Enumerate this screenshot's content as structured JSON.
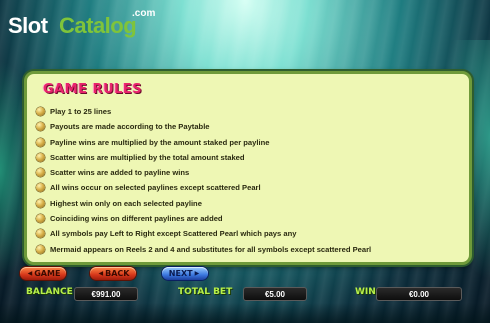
{
  "logo": {
    "slot": "Slot",
    "catalog": "Catalog",
    "com": ".com"
  },
  "panel": {
    "title": "GAME RULES",
    "rules": [
      "Play 1 to 25 lines",
      "Payouts are made according to the Paytable",
      "Payline wins are multiplied by the amount staked per payline",
      "Scatter wins are multiplied by the total amount staked",
      "Scatter wins are added to payline wins",
      "All wins occur on selected paylines except scattered Pearl",
      "Highest win only on each selected payline",
      "Coinciding wins on different paylines are added",
      "All symbols pay Left to Right except Scattered Pearl which pays any",
      "Mermaid appears on Reels 2 and 4 and substitutes for all symbols except scattered Pearl"
    ]
  },
  "nav": {
    "game_label": "GAME",
    "back_label": "BACK",
    "next_label": "NEXT"
  },
  "status": {
    "balance_label": "BALANCE",
    "balance_value": "€991.00",
    "total_bet_label": "TOTAL BET",
    "total_bet_value": "€5.00",
    "win_label": "WIN",
    "win_value": "€0.00"
  },
  "colors": {
    "panel_bg": "#eef7b4",
    "title": "#e8246b",
    "label_green": "#b7f04a",
    "button_red": "#d6371a",
    "button_blue": "#3b78e0"
  },
  "icons": {
    "bullet": "pearl-bullet-icon",
    "arrow_left": "arrow-left-icon",
    "arrow_right": "arrow-right-icon"
  }
}
